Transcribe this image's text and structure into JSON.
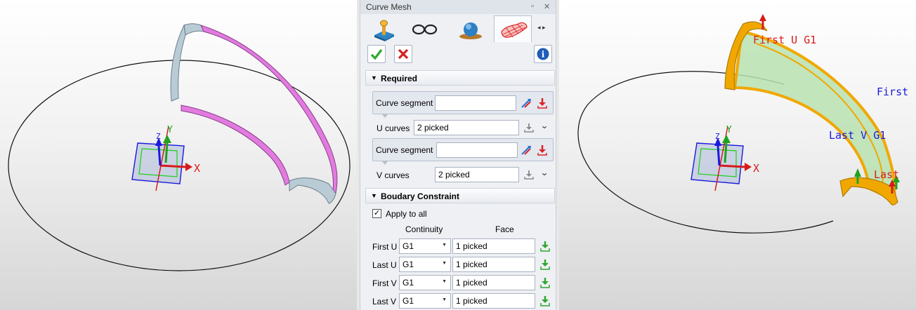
{
  "panel": {
    "title": "Curve Mesh",
    "pin_glyph": "▫",
    "close_glyph": "✕",
    "tab_arrows": "◂ ▸",
    "tabs": [
      {
        "name": "required-inputs-tab",
        "icon": "joystick-icon"
      },
      {
        "name": "display-tab",
        "icon": "glasses-icon"
      },
      {
        "name": "sphere-tab",
        "icon": "sphere-icon"
      },
      {
        "name": "surface-tab",
        "icon": "mesh-surface-icon"
      }
    ],
    "info_glyph": "i",
    "required": {
      "title": "Required",
      "collapse_glyph": "▼",
      "u_segment_label": "Curve segment",
      "u_curves_label": "U curves",
      "u_curves_value": "2 picked",
      "v_segment_label": "Curve segment",
      "v_curves_label": "V curves",
      "v_curves_value": "2 picked",
      "expand_glyph": "⌄"
    },
    "boundary": {
      "title": "Boudary Constraint",
      "collapse_glyph": "▼",
      "apply_to_all": "Apply to all",
      "check_glyph": "✓",
      "continuity_header": "Continuity",
      "face_header": "Face",
      "combo_arrow": "▼",
      "rows": [
        {
          "label": "First U",
          "continuity": "G1",
          "face": "1 picked"
        },
        {
          "label": "Last U",
          "continuity": "G1",
          "face": "1 picked"
        },
        {
          "label": "First V",
          "continuity": "G1",
          "face": "1 picked"
        },
        {
          "label": "Last V",
          "continuity": "G1",
          "face": "1 picked"
        }
      ]
    }
  },
  "viewport_left": {
    "axis_x": "X",
    "axis_y": "Y",
    "axis_z": "Z"
  },
  "viewport_right": {
    "axis_x": "X",
    "axis_y": "Y",
    "axis_z": "Z",
    "labels": [
      "First U G1",
      "First",
      "Last V G1",
      "Last"
    ]
  },
  "colors": {
    "accent_green": "#2ea82e",
    "cancel_red": "#d62020",
    "info_blue": "#1e5db8",
    "selection_orange": "#f0a800",
    "surface_green": "#b8e2b0",
    "highlight_pink": "#e27be0",
    "surface_steel": "#b8cbd6"
  }
}
